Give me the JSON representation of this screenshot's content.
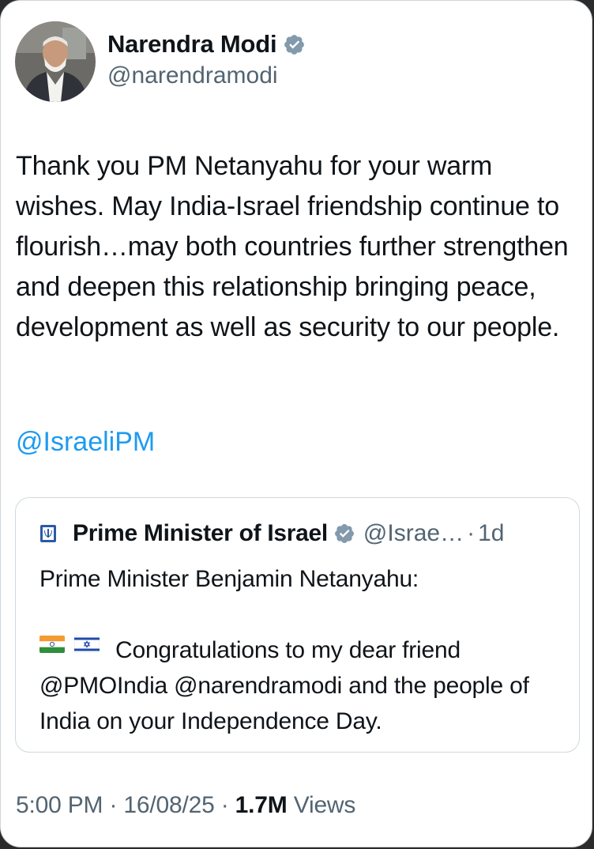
{
  "author": {
    "display_name": "Narendra Modi",
    "handle": "@narendramodi"
  },
  "tweet": {
    "text": "Thank you PM Netanyahu for your warm wishes. May India-Israel friendship continue to flourish…may both countries further strengthen and deepen this relationship bringing peace, development as well as security to our people.",
    "mention": "@IsraeliPM"
  },
  "quoted": {
    "display_name": "Prime Minister of Israel",
    "handle": "@Israe…",
    "separator": "·",
    "time": "1d",
    "line1": "Prime Minister Benjamin Netanyahu:",
    "flags": [
      "india-flag",
      "israel-flag"
    ],
    "line2": "Congratulations to my dear friend @PMOIndia @narendramodi and the people of India on your Independence Day."
  },
  "footer": {
    "time": "5:00 PM",
    "sep1": "·",
    "date": "16/08/25",
    "sep2": "·",
    "views_count": "1.7M",
    "views_label": "Views"
  },
  "colors": {
    "link": "#1d9bf0",
    "secondary_text": "#536471",
    "primary_text": "#0f1419",
    "verified_badge": "#829aab"
  }
}
